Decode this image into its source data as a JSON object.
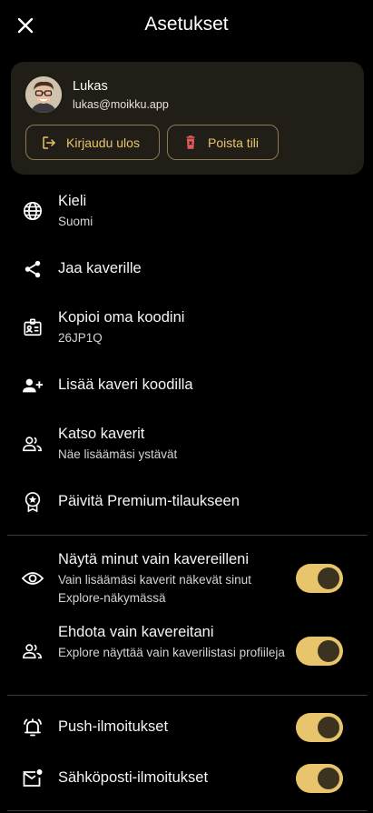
{
  "header": {
    "title": "Asetukset",
    "close_icon": "close-icon"
  },
  "account": {
    "name": "Lukas",
    "email": "lukas@moikku.app",
    "logout_label": "Kirjaudu ulos",
    "delete_label": "Poista tili"
  },
  "menu": {
    "language": {
      "title": "Kieli",
      "subtitle": "Suomi",
      "icon": "globe-icon"
    },
    "share": {
      "title": "Jaa kaverille",
      "icon": "share-icon"
    },
    "copy_code": {
      "title": "Kopioi oma koodini",
      "subtitle": "26JP1Q",
      "icon": "badge-icon"
    },
    "add_friend": {
      "title": "Lisää kaveri koodilla",
      "icon": "person-add-icon"
    },
    "view_friends": {
      "title": "Katso kaverit",
      "subtitle": "Näe lisäämäsi ystävät",
      "icon": "people-icon"
    },
    "premium": {
      "title": "Päivitä Premium-tilaukseen",
      "icon": "premium-icon"
    }
  },
  "privacy": {
    "visible_to_friends": {
      "title": "Näytä minut vain kavereilleni",
      "subtitle": "Vain lisäämäsi kaverit näkevät sinut Explore-näkymässä",
      "enabled": true
    },
    "suggest_friends": {
      "title": "Ehdota vain kavereitani",
      "subtitle": "Explore näyttää vain kaverilistasi profiileja",
      "enabled": true
    }
  },
  "notifications": {
    "push": {
      "title": "Push-ilmoitukset",
      "enabled": true
    },
    "email": {
      "title": "Sähköposti-ilmoitukset",
      "enabled": true
    }
  },
  "colors": {
    "accent": "#e8c56c",
    "card_bg": "#211e17",
    "background": "#000000"
  }
}
